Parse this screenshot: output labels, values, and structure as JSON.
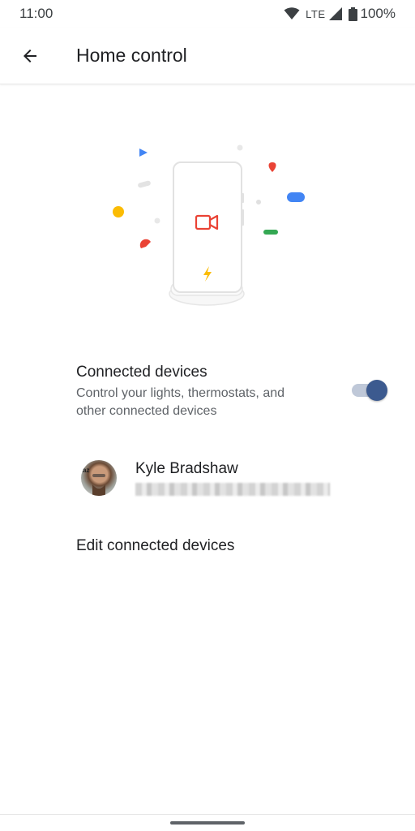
{
  "status_bar": {
    "time": "11:00",
    "network": "LTE",
    "battery": "100%"
  },
  "app_bar": {
    "title": "Home control",
    "back_icon": "arrow-back-icon"
  },
  "illustration": {
    "icons": [
      "phone-on-charging-stand",
      "video-camera-icon",
      "lightning-bolt-icon"
    ],
    "colors": {
      "blue": "#4285f4",
      "red": "#ea4335",
      "yellow": "#fbbc04",
      "green": "#34a853",
      "grey": "#dadce0"
    }
  },
  "connected_devices": {
    "title": "Connected devices",
    "subtitle": "Control your lights, thermostats, and other connected devices",
    "toggle_on": true
  },
  "account": {
    "name": "Kyle Bradshaw",
    "email": "●●●●●●●●●●●●●●●●●●●●●●●●●●●●"
  },
  "edit_link": "Edit connected devices",
  "colors": {
    "toggle_thumb": "#3c5a8f",
    "toggle_track": "#bfc8d8"
  }
}
